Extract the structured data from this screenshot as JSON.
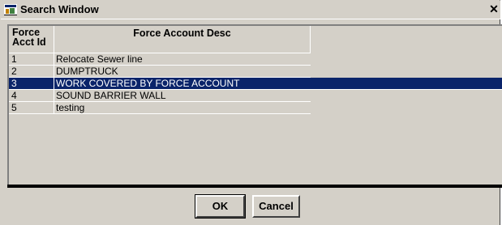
{
  "window": {
    "title": "Search Window",
    "close_glyph": "✕"
  },
  "table": {
    "columns": [
      "Force Acct Id",
      "Force Account Desc"
    ],
    "column_id_line1": "Force",
    "column_id_line2": "Acct Id",
    "rows": [
      {
        "id": "1",
        "desc": "Relocate Sewer line",
        "selected": false
      },
      {
        "id": "2",
        "desc": "DUMPTRUCK",
        "selected": false
      },
      {
        "id": "3",
        "desc": "WORK COVERED BY FORCE ACCOUNT",
        "selected": true
      },
      {
        "id": "4",
        "desc": "SOUND BARRIER WALL",
        "selected": false
      },
      {
        "id": "5",
        "desc": "testing",
        "selected": false
      }
    ]
  },
  "buttons": {
    "ok": "OK",
    "cancel": "Cancel"
  },
  "colors": {
    "selection": "#0a246a",
    "face": "#d4d0c8"
  },
  "icons": {
    "title": "app-window-icon",
    "close": "close-icon"
  }
}
